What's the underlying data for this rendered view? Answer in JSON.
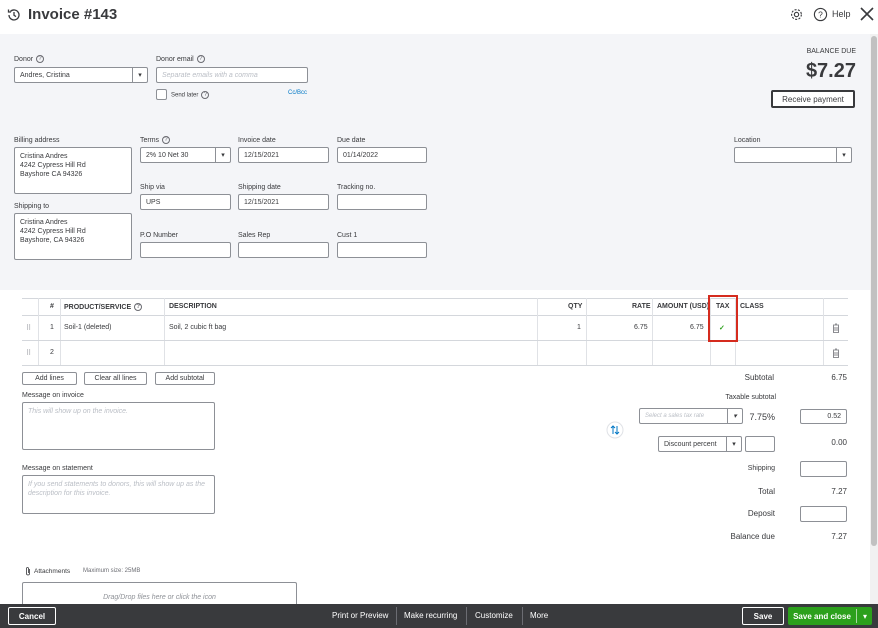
{
  "header": {
    "title": "Invoice #143",
    "help_label": "Help"
  },
  "donor": {
    "label": "Donor",
    "value": "Andres, Cristina"
  },
  "donor_email": {
    "label": "Donor email",
    "placeholder": "Separate emails with a comma",
    "send_later_label": "Send later",
    "cc_bcc_link": "Cc/Bcc"
  },
  "balance": {
    "label": "BALANCE DUE",
    "amount": "$7.27",
    "receive_payment_label": "Receive payment"
  },
  "billing_address": {
    "label": "Billing address",
    "line1": "Cristina Andres",
    "line2": "4242 Cypress Hill Rd",
    "line3": "Bayshore CA 94326"
  },
  "shipping_to": {
    "label": "Shipping to",
    "line1": "Cristina Andres",
    "line2": "4242 Cypress Hill Rd",
    "line3": "Bayshore, CA  94326"
  },
  "terms": {
    "label": "Terms",
    "value": "2% 10 Net 30"
  },
  "invoice_date": {
    "label": "Invoice date",
    "value": "12/15/2021"
  },
  "due_date": {
    "label": "Due date",
    "value": "01/14/2022"
  },
  "location": {
    "label": "Location",
    "value": ""
  },
  "ship_via": {
    "label": "Ship via",
    "value": "UPS"
  },
  "shipping_date": {
    "label": "Shipping date",
    "value": "12/15/2021"
  },
  "tracking_no": {
    "label": "Tracking no.",
    "value": ""
  },
  "po_number": {
    "label": "P.O Number",
    "value": ""
  },
  "sales_rep": {
    "label": "Sales Rep",
    "value": ""
  },
  "cust1": {
    "label": "Cust 1",
    "value": ""
  },
  "table": {
    "headers": {
      "num": "#",
      "product": "PRODUCT/SERVICE",
      "description": "DESCRIPTION",
      "qty": "QTY",
      "rate": "RATE",
      "amount": "AMOUNT (USD)",
      "tax": "TAX",
      "class": "CLASS"
    },
    "rows": [
      {
        "num": "1",
        "product": "Soil-1 (deleted)",
        "description": "Soil, 2 cubic ft bag",
        "qty": "1",
        "rate": "6.75",
        "amount": "6.75",
        "tax": "✓",
        "class": ""
      },
      {
        "num": "2",
        "product": "",
        "description": "",
        "qty": "",
        "rate": "",
        "amount": "",
        "tax": "",
        "class": ""
      }
    ]
  },
  "table_buttons": {
    "add_lines": "Add lines",
    "clear_all": "Clear all lines",
    "add_subtotal": "Add subtotal"
  },
  "message_invoice": {
    "label": "Message on invoice",
    "placeholder": "This will show up on the invoice."
  },
  "message_statement": {
    "label": "Message on statement",
    "placeholder": "If you send statements to donors, this will show up as the description for this invoice."
  },
  "totals": {
    "subtotal_label": "Subtotal",
    "subtotal_value": "6.75",
    "taxable_subtotal_label": "Taxable subtotal",
    "tax_rate_placeholder": "Select a sales tax rate",
    "tax_rate_percent": "7.75%",
    "tax_amount": "0.52",
    "discount_select": "Discount percent",
    "discount_value": "0.00",
    "shipping_label": "Shipping",
    "total_label": "Total",
    "total_value": "7.27",
    "deposit_label": "Deposit",
    "balance_due_label": "Balance due",
    "balance_due_value": "7.27"
  },
  "attachments": {
    "label": "Attachments",
    "max_size": "Maximum size: 25MB",
    "drop_text": "Drag/Drop files here or click the icon"
  },
  "footer": {
    "cancel": "Cancel",
    "print_preview": "Print or Preview",
    "make_recurring": "Make recurring",
    "customize": "Customize",
    "more": "More",
    "save": "Save",
    "save_close": "Save and close"
  },
  "colors": {
    "accent_green": "#2ca01c",
    "footer_bg": "#393a3d",
    "panel_bg": "#f4f5f8",
    "highlight_red": "#d52b1e"
  }
}
